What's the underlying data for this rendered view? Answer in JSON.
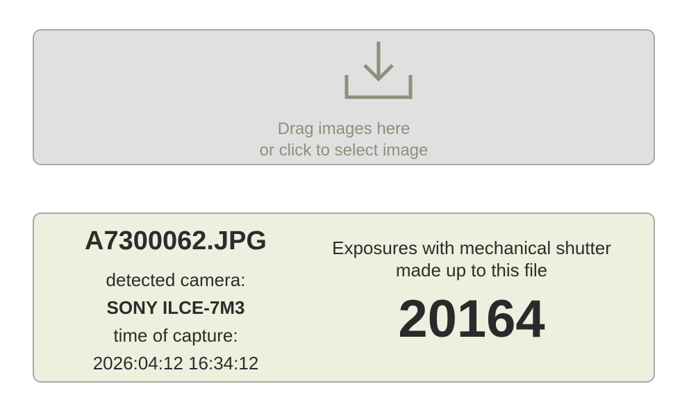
{
  "dropzone": {
    "icon": "download-icon",
    "line1": "Drag images here",
    "line2": "or click to select image"
  },
  "result": {
    "filename": "A7300062.JPG",
    "camera_label": "detected camera:",
    "camera": "SONY ILCE-7M3",
    "time_label": "time of capture:",
    "time": "2026:04:12 16:34:12",
    "exposures_label_line1": "Exposures with mechanical shutter",
    "exposures_label_line2": "made up to this file",
    "count": "20164"
  },
  "colors": {
    "dropzone_bg": "#e0e0e0",
    "result_bg": "#efefdf",
    "muted_text": "#8f8f7c",
    "text": "#2c2c2c"
  }
}
